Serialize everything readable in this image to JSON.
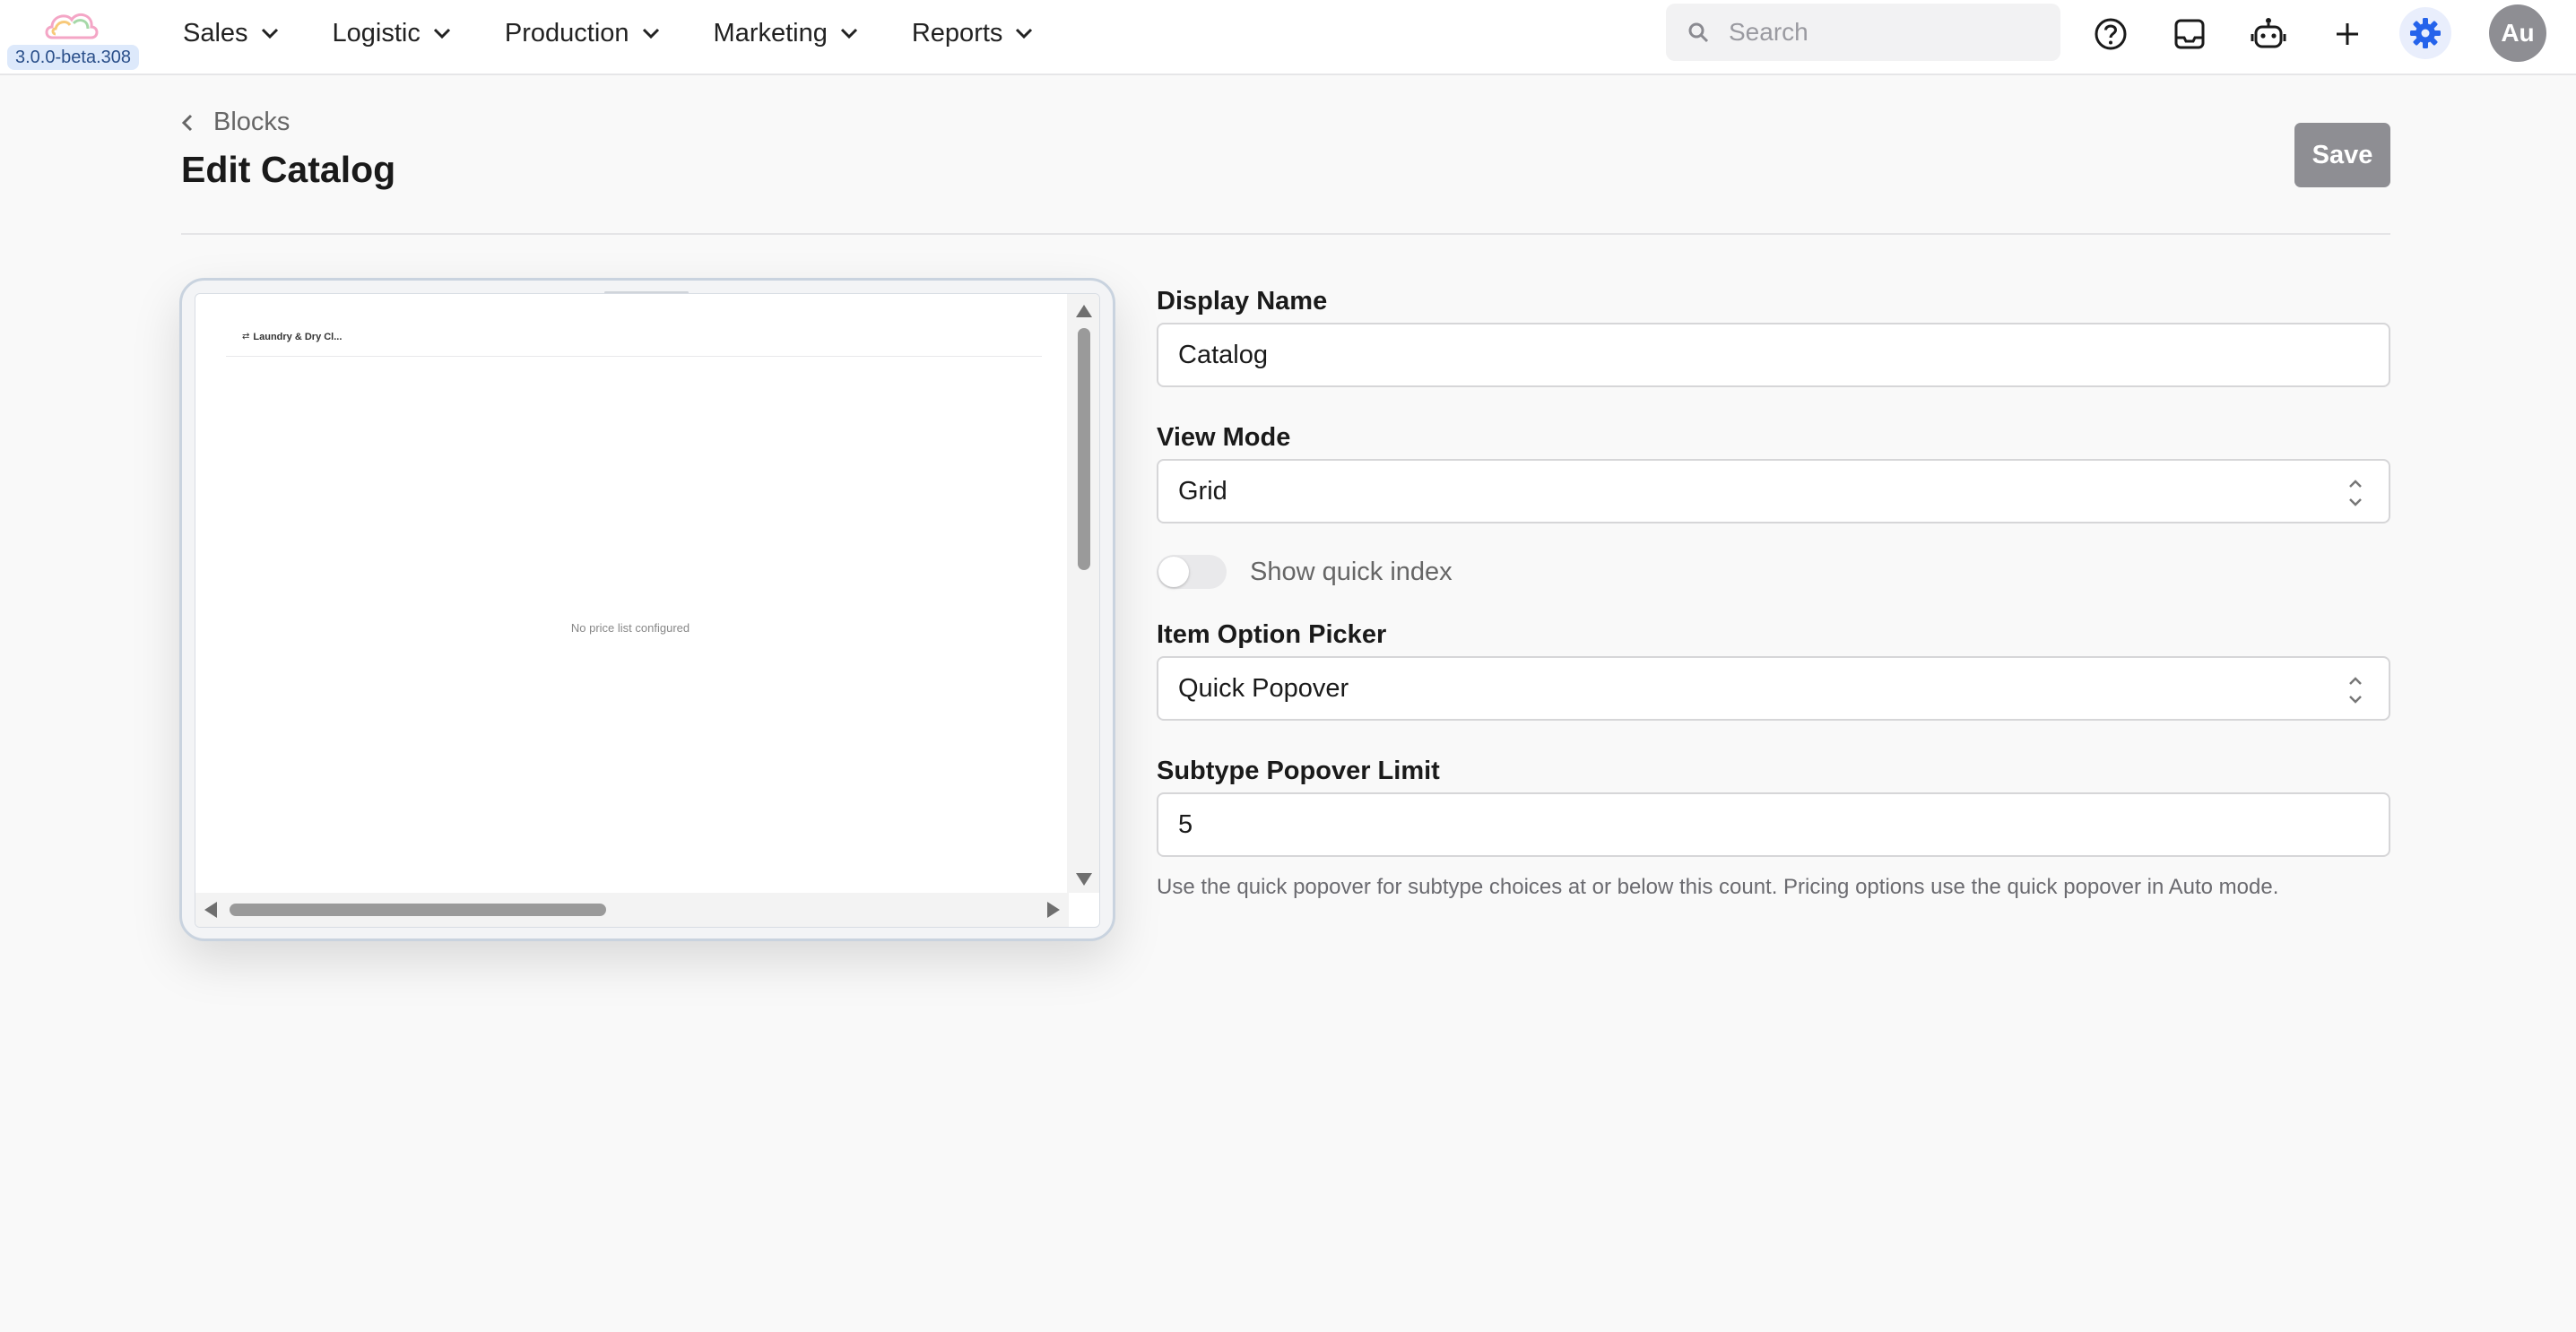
{
  "app": {
    "version": "3.0.0-beta.308"
  },
  "nav": {
    "items": [
      {
        "label": "Sales"
      },
      {
        "label": "Logistic"
      },
      {
        "label": "Production"
      },
      {
        "label": "Marketing"
      },
      {
        "label": "Reports"
      }
    ],
    "search_placeholder": "Search",
    "avatar_initials": "Au",
    "icons": [
      "help-icon",
      "inbox-icon",
      "robot-icon",
      "plus-icon",
      "gear-icon"
    ]
  },
  "header": {
    "breadcrumb": "Blocks",
    "title": "Edit Catalog",
    "save_label": "Save"
  },
  "preview": {
    "header_title": "Laundry & Dry Cl...",
    "empty_message": "No price list configured"
  },
  "form": {
    "display_name": {
      "label": "Display Name",
      "value": "Catalog"
    },
    "view_mode": {
      "label": "View Mode",
      "value": "Grid"
    },
    "quick_index": {
      "label": "Show quick index",
      "enabled": false
    },
    "item_option_picker": {
      "label": "Item Option Picker",
      "value": "Quick Popover"
    },
    "subtype_popover_limit": {
      "label": "Subtype Popover Limit",
      "value": "5",
      "help": "Use the quick popover for subtype choices at or below this count. Pricing options use the quick popover in Auto mode."
    }
  },
  "colors": {
    "accent": "#2563eb",
    "save_button": "#8e8e93",
    "version_badge_bg": "#dde9fb"
  }
}
